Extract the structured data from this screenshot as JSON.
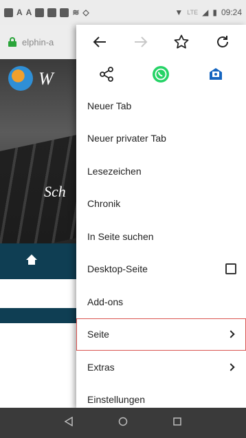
{
  "status_bar": {
    "time": "09:24",
    "network": "LTE"
  },
  "url_bar": {
    "url_partial": "elphin-a"
  },
  "page": {
    "hero_logo_text": "W",
    "hero_script": "Sch"
  },
  "menu": {
    "items": [
      {
        "label": "Neuer Tab"
      },
      {
        "label": "Neuer privater Tab"
      },
      {
        "label": "Lesezeichen"
      },
      {
        "label": "Chronik"
      },
      {
        "label": "In Seite suchen"
      },
      {
        "label": "Desktop-Seite"
      },
      {
        "label": "Add-ons"
      },
      {
        "label": "Seite"
      },
      {
        "label": "Extras"
      },
      {
        "label": "Einstellungen"
      }
    ]
  },
  "colors": {
    "accent_green": "#2aa43a",
    "whatsapp": "#25d366",
    "highlight_border": "#d9534f",
    "navbar": "#0f3e53"
  }
}
